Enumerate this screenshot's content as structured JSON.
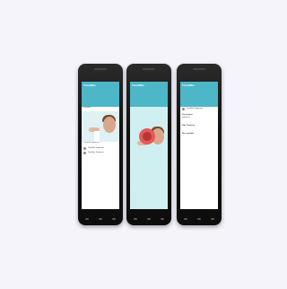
{
  "phones": [
    {
      "app_title": "Tonsillitis",
      "app_subtitle": "",
      "tab": "",
      "body": [
        "Tonsillitis",
        "Tonsillitis Symptoms"
      ],
      "section": "",
      "list": [
        "Tonsillitis Symptoms",
        "Tonsillitis Treatment"
      ]
    },
    {
      "app_title": "Tonsillitis",
      "app_subtitle": "",
      "tab": ""
    },
    {
      "app_title": "Tonsillitis",
      "app_subtitle": "",
      "tab": "",
      "body": [
        "Prescription",
        "Antibiotics",
        "Side Treatment",
        "Also available"
      ],
      "list": [
        "Tonsillitis Symptoms"
      ]
    }
  ],
  "colors": {
    "accent": "#4db6c7",
    "background": "#f5f4fb",
    "phone": "#111111"
  }
}
